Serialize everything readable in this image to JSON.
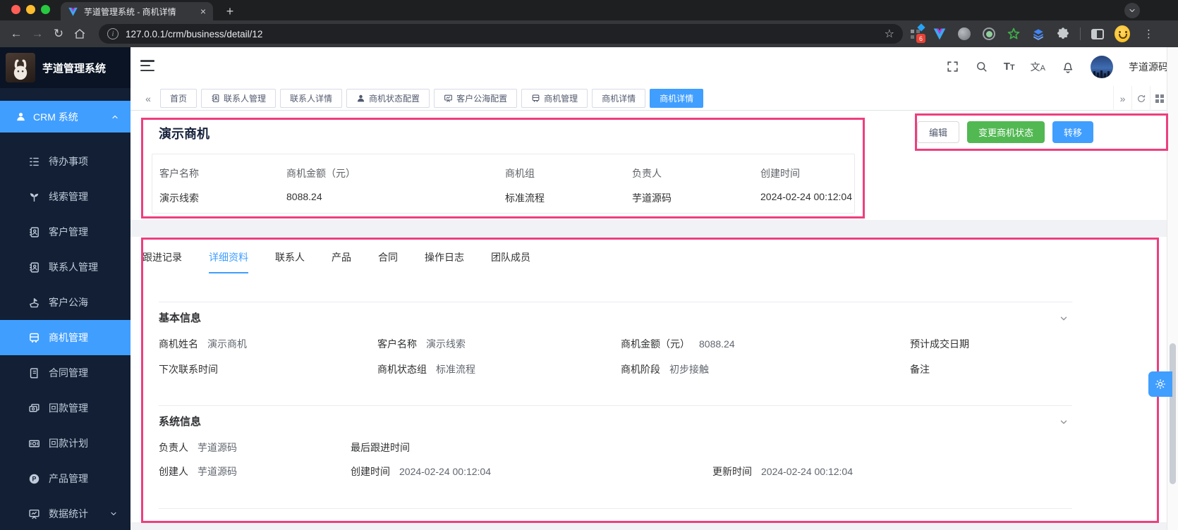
{
  "browser": {
    "tab_title": "芋道管理系统 - 商机详情",
    "url": "127.0.0.1/crm/business/detail/12",
    "extension_badge": "6"
  },
  "header": {
    "logo_title": "芋道管理系统",
    "username": "芋道源码"
  },
  "sidebar": {
    "parent_label": "CRM 系统",
    "items": [
      {
        "label": "待办事项"
      },
      {
        "label": "线索管理"
      },
      {
        "label": "客户管理"
      },
      {
        "label": "联系人管理"
      },
      {
        "label": "客户公海"
      },
      {
        "label": "商机管理"
      },
      {
        "label": "合同管理"
      },
      {
        "label": "回款管理"
      },
      {
        "label": "回款计划"
      },
      {
        "label": "产品管理"
      },
      {
        "label": "数据统计"
      }
    ]
  },
  "tabbar": {
    "tabs": [
      {
        "label": "首页"
      },
      {
        "label": "联系人管理"
      },
      {
        "label": "联系人详情"
      },
      {
        "label": "商机状态配置"
      },
      {
        "label": "客户公海配置"
      },
      {
        "label": "商机管理"
      },
      {
        "label": "商机详情"
      },
      {
        "label": "商机详情"
      }
    ]
  },
  "page": {
    "title": "演示商机",
    "actions": {
      "edit": "编辑",
      "change_status": "变更商机状态",
      "transfer": "转移"
    },
    "summary": [
      {
        "label": "客户名称",
        "value": "演示线索"
      },
      {
        "label": "商机金额（元）",
        "value": "8088.24"
      },
      {
        "label": "商机组",
        "value": "标准流程"
      },
      {
        "label": "负责人",
        "value": "芋道源码"
      },
      {
        "label": "创建时间",
        "value": "2024-02-24 00:12:04"
      }
    ],
    "tabs": [
      {
        "label": "跟进记录"
      },
      {
        "label": "详细资料"
      },
      {
        "label": "联系人"
      },
      {
        "label": "产品"
      },
      {
        "label": "合同"
      },
      {
        "label": "操作日志"
      },
      {
        "label": "团队成员"
      }
    ],
    "basic": {
      "title": "基本信息",
      "rows": [
        [
          {
            "label": "商机姓名",
            "value": "演示商机"
          },
          {
            "label": "客户名称",
            "value": "演示线索"
          },
          {
            "label": "商机金额（元）",
            "value": "8088.24"
          },
          {
            "label": "预计成交日期",
            "value": ""
          }
        ],
        [
          {
            "label": "下次联系时间",
            "value": ""
          },
          {
            "label": "商机状态组",
            "value": "标准流程"
          },
          {
            "label": "商机阶段",
            "value": "初步接触"
          },
          {
            "label": "备注",
            "value": ""
          }
        ]
      ]
    },
    "system": {
      "title": "系统信息",
      "rows": [
        [
          {
            "label": "负责人",
            "value": "芋道源码"
          },
          {
            "label": "最后跟进时间",
            "value": ""
          }
        ],
        [
          {
            "label": "创建人",
            "value": "芋道源码"
          },
          {
            "label": "创建时间",
            "value": "2024-02-24 00:12:04"
          },
          {
            "label": "更新时间",
            "value": "2024-02-24 00:12:04"
          }
        ]
      ]
    }
  }
}
